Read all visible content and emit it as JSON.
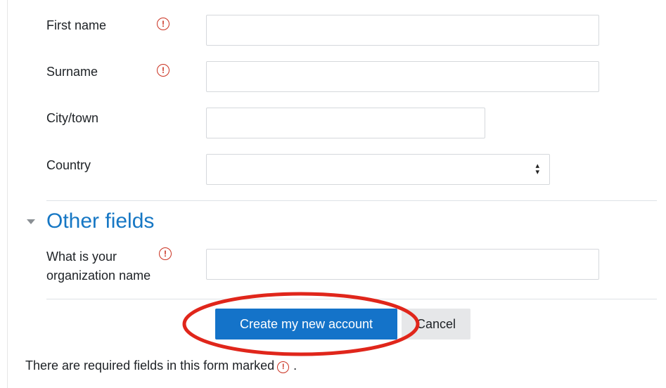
{
  "form": {
    "fields": [
      {
        "label": "First name",
        "required": true,
        "value": ""
      },
      {
        "label": "Surname",
        "required": true,
        "value": ""
      },
      {
        "label": "City/town",
        "required": false,
        "value": ""
      },
      {
        "label": "Country",
        "required": false,
        "value": ""
      }
    ],
    "other_section": {
      "title": "Other fields",
      "org_label_line1": "What is your",
      "org_label_line2": "organization name",
      "org_value": ""
    },
    "submit_label": "Create my new account",
    "cancel_label": "Cancel",
    "required_note": "There are required fields in this form marked",
    "required_note_end": "."
  },
  "colors": {
    "accent": "#1473c9",
    "required": "#ca3120",
    "highlight": "#e0261b",
    "section_title": "#1677c4"
  },
  "icons": {
    "required": "exclamation-circle-icon",
    "section_toggle": "caret-down-icon",
    "select": "up-down-arrows-icon"
  }
}
